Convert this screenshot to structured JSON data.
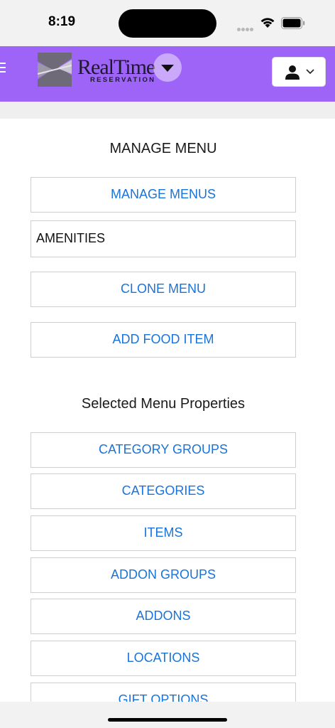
{
  "status_bar": {
    "time": "8:19"
  },
  "header": {
    "brand_title": "RealTime",
    "brand_subtitle": "RESERVATION",
    "accent_color": "#9e63f7"
  },
  "manage": {
    "title": "MANAGE MENU",
    "manage_menus_label": "MANAGE MENUS",
    "selected_menu": "AMENITIES",
    "clone_menu_label": "CLONE MENU",
    "add_food_item_label": "ADD FOOD ITEM"
  },
  "properties": {
    "title": "Selected Menu Properties",
    "items": [
      {
        "label": "CATEGORY GROUPS"
      },
      {
        "label": "CATEGORIES"
      },
      {
        "label": "ITEMS"
      },
      {
        "label": "ADDON GROUPS"
      },
      {
        "label": "ADDONS"
      },
      {
        "label": "LOCATIONS"
      },
      {
        "label": "GIFT OPTIONS"
      }
    ]
  }
}
